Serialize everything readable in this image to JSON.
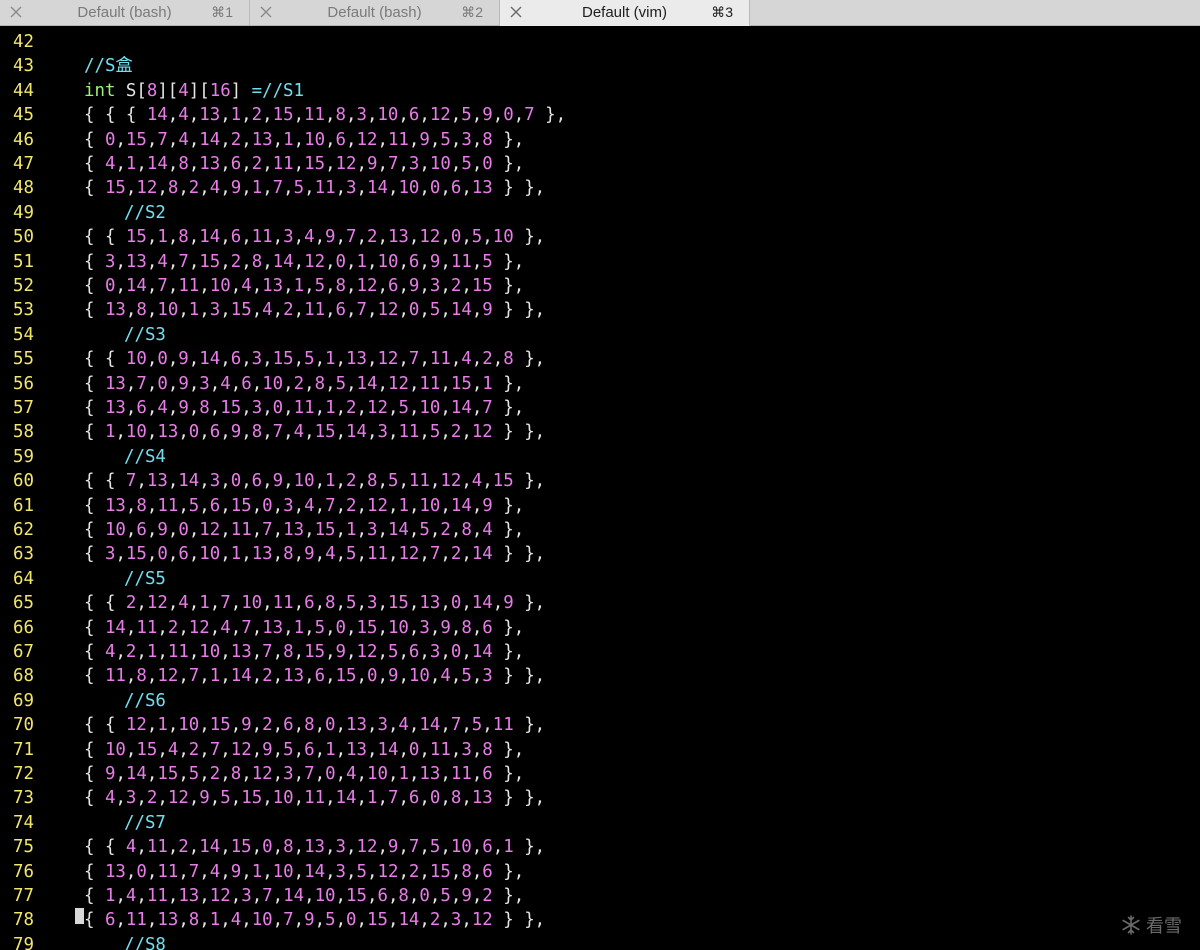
{
  "tabs": [
    {
      "title": "Default (bash)",
      "shortcut": "⌘1",
      "active": false
    },
    {
      "title": "Default (bash)",
      "shortcut": "⌘2",
      "active": false
    },
    {
      "title": "Default (vim)",
      "shortcut": "⌘3",
      "active": true
    }
  ],
  "colors": {
    "line_number": "#f2e66b",
    "comment": "#6ee0ef",
    "number": "#e87de8",
    "type": "#9ef07a",
    "text": "#e6e6e6",
    "background": "#000000"
  },
  "lines": [
    {
      "num": "42",
      "kind": "blank",
      "text": ""
    },
    {
      "num": "43",
      "kind": "comment",
      "text": "//S盒"
    },
    {
      "num": "44",
      "kind": "decl",
      "text": "int S[8][4][16] =//S1"
    },
    {
      "num": "45",
      "kind": "row",
      "text": "{ { { 14,4,13,1,2,15,11,8,3,10,6,12,5,9,0,7 },"
    },
    {
      "num": "46",
      "kind": "row",
      "text": "{ 0,15,7,4,14,2,13,1,10,6,12,11,9,5,3,8 },"
    },
    {
      "num": "47",
      "kind": "row",
      "text": "{ 4,1,14,8,13,6,2,11,15,12,9,7,3,10,5,0 },"
    },
    {
      "num": "48",
      "kind": "row",
      "text": "{ 15,12,8,2,4,9,1,7,5,11,3,14,10,0,6,13 } },"
    },
    {
      "num": "49",
      "kind": "indent-comment",
      "text": "//S2"
    },
    {
      "num": "50",
      "kind": "row",
      "text": "{ { 15,1,8,14,6,11,3,4,9,7,2,13,12,0,5,10 },"
    },
    {
      "num": "51",
      "kind": "row",
      "text": "{ 3,13,4,7,15,2,8,14,12,0,1,10,6,9,11,5 },"
    },
    {
      "num": "52",
      "kind": "row",
      "text": "{ 0,14,7,11,10,4,13,1,5,8,12,6,9,3,2,15 },"
    },
    {
      "num": "53",
      "kind": "row",
      "text": "{ 13,8,10,1,3,15,4,2,11,6,7,12,0,5,14,9 } },"
    },
    {
      "num": "54",
      "kind": "indent-comment",
      "text": "//S3"
    },
    {
      "num": "55",
      "kind": "row",
      "text": "{ { 10,0,9,14,6,3,15,5,1,13,12,7,11,4,2,8 },"
    },
    {
      "num": "56",
      "kind": "row",
      "text": "{ 13,7,0,9,3,4,6,10,2,8,5,14,12,11,15,1 },"
    },
    {
      "num": "57",
      "kind": "row",
      "text": "{ 13,6,4,9,8,15,3,0,11,1,2,12,5,10,14,7 },"
    },
    {
      "num": "58",
      "kind": "row",
      "text": "{ 1,10,13,0,6,9,8,7,4,15,14,3,11,5,2,12 } },"
    },
    {
      "num": "59",
      "kind": "indent-comment",
      "text": "//S4"
    },
    {
      "num": "60",
      "kind": "row",
      "text": "{ { 7,13,14,3,0,6,9,10,1,2,8,5,11,12,4,15 },"
    },
    {
      "num": "61",
      "kind": "row",
      "text": "{ 13,8,11,5,6,15,0,3,4,7,2,12,1,10,14,9 },"
    },
    {
      "num": "62",
      "kind": "row",
      "text": "{ 10,6,9,0,12,11,7,13,15,1,3,14,5,2,8,4 },"
    },
    {
      "num": "63",
      "kind": "row",
      "text": "{ 3,15,0,6,10,1,13,8,9,4,5,11,12,7,2,14 } },"
    },
    {
      "num": "64",
      "kind": "indent-comment",
      "text": "//S5"
    },
    {
      "num": "65",
      "kind": "row",
      "text": "{ { 2,12,4,1,7,10,11,6,8,5,3,15,13,0,14,9 },"
    },
    {
      "num": "66",
      "kind": "row",
      "text": "{ 14,11,2,12,4,7,13,1,5,0,15,10,3,9,8,6 },"
    },
    {
      "num": "67",
      "kind": "row",
      "text": "{ 4,2,1,11,10,13,7,8,15,9,12,5,6,3,0,14 },"
    },
    {
      "num": "68",
      "kind": "row",
      "text": "{ 11,8,12,7,1,14,2,13,6,15,0,9,10,4,5,3 } },"
    },
    {
      "num": "69",
      "kind": "indent-comment",
      "text": "//S6"
    },
    {
      "num": "70",
      "kind": "row",
      "text": "{ { 12,1,10,15,9,2,6,8,0,13,3,4,14,7,5,11 },"
    },
    {
      "num": "71",
      "kind": "row",
      "text": "{ 10,15,4,2,7,12,9,5,6,1,13,14,0,11,3,8 },"
    },
    {
      "num": "72",
      "kind": "row",
      "text": "{ 9,14,15,5,2,8,12,3,7,0,4,10,1,13,11,6 },"
    },
    {
      "num": "73",
      "kind": "row",
      "text": "{ 4,3,2,12,9,5,15,10,11,14,1,7,6,0,8,13 } },"
    },
    {
      "num": "74",
      "kind": "indent-comment",
      "text": "//S7"
    },
    {
      "num": "75",
      "kind": "row",
      "text": "{ { 4,11,2,14,15,0,8,13,3,12,9,7,5,10,6,1 },"
    },
    {
      "num": "76",
      "kind": "row",
      "text": "{ 13,0,11,7,4,9,1,10,14,3,5,12,2,15,8,6 },"
    },
    {
      "num": "77",
      "kind": "row",
      "text": "{ 1,4,11,13,12,3,7,14,10,15,6,8,0,5,9,2 },"
    },
    {
      "num": "78",
      "kind": "row",
      "text": "{ 6,11,13,8,1,4,10,7,9,5,0,15,14,2,3,12 } },"
    },
    {
      "num": "79",
      "kind": "indent-comment",
      "text": "//S8"
    }
  ],
  "watermark": {
    "icon": "snowflake-icon",
    "text": "看雪"
  }
}
